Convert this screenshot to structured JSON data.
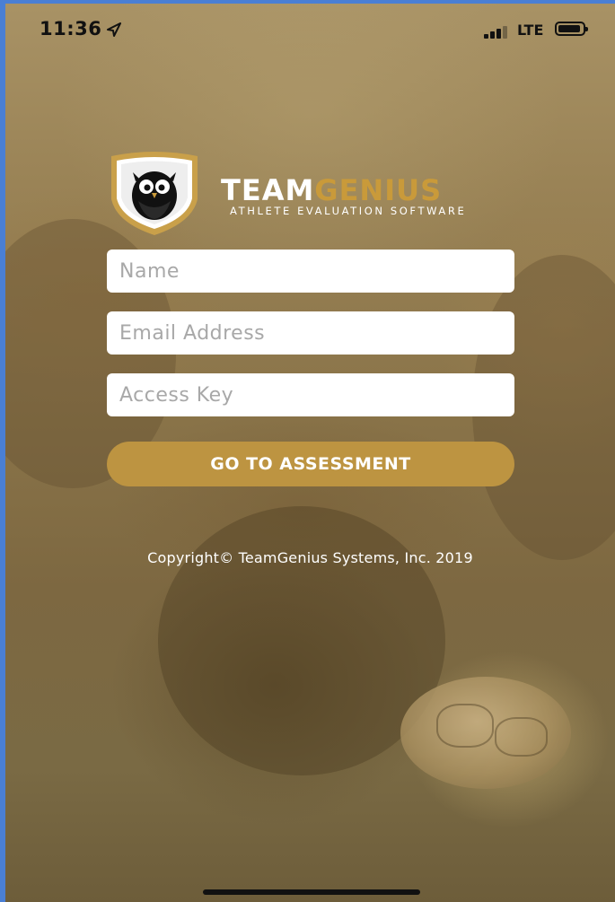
{
  "status_bar": {
    "time": "11:36",
    "network": "LTE",
    "location_icon": "location-arrow-icon",
    "signal_icon": "cellular-signal-icon",
    "battery_icon": "battery-icon"
  },
  "brand": {
    "team": "TEAM",
    "genius": "GENIUS",
    "tagline": "ATHLETE EVALUATION SOFTWARE",
    "logo_icon": "owl-shield-icon",
    "colors": {
      "gold": "#bd9441",
      "white": "#ffffff"
    }
  },
  "form": {
    "name_placeholder": "Name",
    "email_placeholder": "Email Address",
    "access_key_placeholder": "Access Key",
    "submit_label": "GO TO ASSESSMENT"
  },
  "footer": {
    "copyright": "Copyright© TeamGenius Systems, Inc. 2019"
  }
}
